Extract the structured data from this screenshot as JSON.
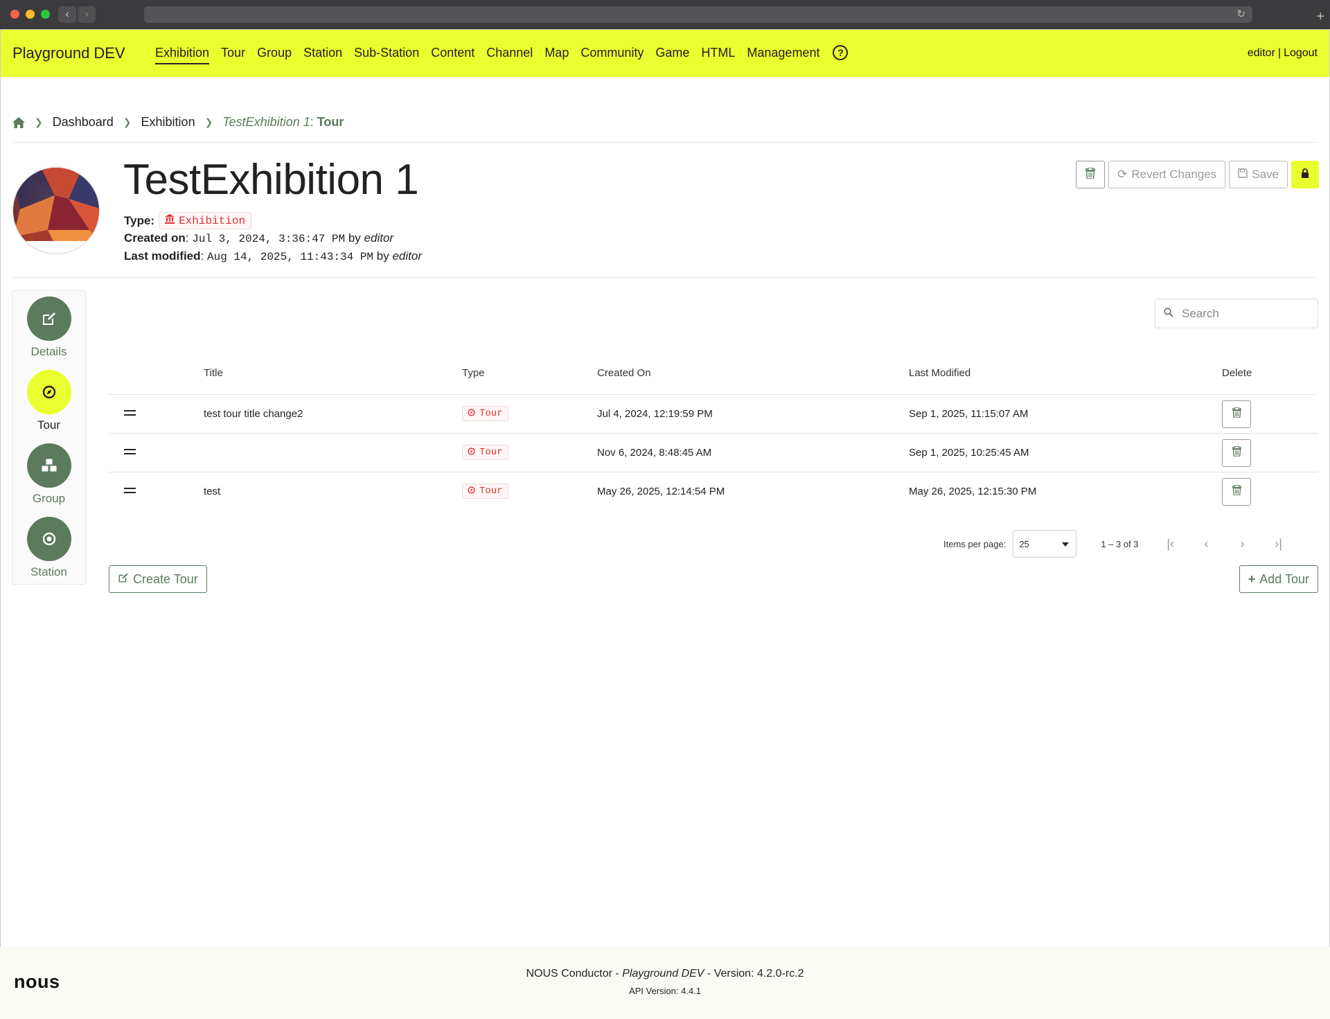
{
  "app": {
    "brand": "Playground DEV",
    "user": "editor",
    "logout_label": "Logout",
    "accent_color": "#eaff2f",
    "primary_color": "#5b7b5c"
  },
  "nav": {
    "items": [
      {
        "label": "Exhibition",
        "active": true
      },
      {
        "label": "Tour"
      },
      {
        "label": "Group"
      },
      {
        "label": "Station"
      },
      {
        "label": "Sub-Station"
      },
      {
        "label": "Content"
      },
      {
        "label": "Channel"
      },
      {
        "label": "Map"
      },
      {
        "label": "Community"
      },
      {
        "label": "Game"
      },
      {
        "label": "HTML"
      },
      {
        "label": "Management"
      }
    ],
    "help_icon": "?"
  },
  "breadcrumb": {
    "items": [
      "Dashboard",
      "Exhibition"
    ],
    "current_name": "TestExhibition 1",
    "current_colon": ":",
    "current_section": "Tour"
  },
  "header": {
    "title": "TestExhibition 1",
    "type_label": "Type:",
    "type_value": "Exhibition",
    "created_label": "Created on",
    "created_colon": ":",
    "created_value": "Jul 3, 2024, 3:36:47 PM",
    "created_by_word": "by",
    "created_by": "editor",
    "modified_label": "Last modified",
    "modified_colon": ":",
    "modified_value": "Aug 14, 2025, 11:43:34 PM",
    "modified_by_word": "by",
    "modified_by": "editor",
    "revert_label": "Revert Changes",
    "save_label": "Save"
  },
  "sidebar": {
    "items": [
      {
        "label": "Details",
        "icon": "edit-icon"
      },
      {
        "label": "Tour",
        "icon": "compass-icon",
        "active": true
      },
      {
        "label": "Group",
        "icon": "cubes-icon"
      },
      {
        "label": "Station",
        "icon": "dot-circle-icon"
      }
    ]
  },
  "search": {
    "placeholder": "Search"
  },
  "table": {
    "columns": [
      "Title",
      "Type",
      "Created On",
      "Last Modified",
      "Delete"
    ],
    "rows": [
      {
        "title": "test tour title change2",
        "type": "Tour",
        "created": "Jul 4, 2024, 12:19:59 PM",
        "modified": "Sep 1, 2025, 11:15:07 AM"
      },
      {
        "title": "",
        "type": "Tour",
        "created": "Nov 6, 2024, 8:48:45 AM",
        "modified": "Sep 1, 2025, 10:25:45 AM"
      },
      {
        "title": "test",
        "type": "Tour",
        "created": "May 26, 2025, 12:14:54 PM",
        "modified": "May 26, 2025, 12:15:30 PM"
      }
    ]
  },
  "paginator": {
    "items_per_page_label": "Items per page:",
    "items_per_page": "25",
    "range": "1 – 3 of 3"
  },
  "actions": {
    "create_label": "Create Tour",
    "add_label": "Add Tour"
  },
  "footer": {
    "logo": "nous",
    "product": "NOUS Conductor",
    "dash1": " - ",
    "instance": "Playground DEV",
    "dash2": " - Version: ",
    "version": "4.2.0-rc.2",
    "api_prefix": "API Version: ",
    "api_version": "4.4.1"
  }
}
